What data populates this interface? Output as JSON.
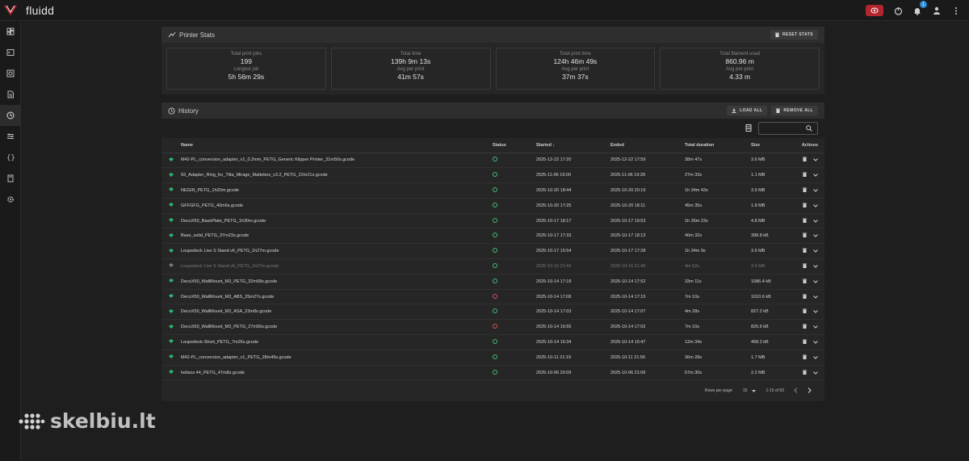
{
  "app": {
    "title": "fluidd",
    "notification_count": "1"
  },
  "icons": {
    "logo": "fluidd-logo-icon",
    "estop": "emergency-stop-icon",
    "sidebar": [
      "dashboard-icon",
      "console-icon",
      "camera-icon",
      "jobs-icon",
      "history-icon",
      "tune-icon",
      "config-icon",
      "system-icon",
      "settings-icon"
    ]
  },
  "colors": {
    "accent": "#2e8bd6",
    "success": "#3fbf6f",
    "error": "#e05050",
    "estop": "#b3262e",
    "file_icon": "#2bb673"
  },
  "stats_panel": {
    "title": "Printer Stats",
    "reset_label": "RESET STATS",
    "cards": [
      {
        "label1": "Total print jobs",
        "value1": "199",
        "label2": "Longest job",
        "value2": "5h 56m 29s"
      },
      {
        "label1": "Total time",
        "value1": "139h 9m 13s",
        "label2": "Avg per print",
        "value2": "41m 57s"
      },
      {
        "label1": "Total print time",
        "value1": "124h 46m 49s",
        "label2": "Avg per print",
        "value2": "37m 37s"
      },
      {
        "label1": "Total filament used",
        "value1": "860.96 m",
        "label2": "Avg per print",
        "value2": "4.33 m"
      }
    ]
  },
  "history": {
    "title": "History",
    "load_all": "LOAD ALL",
    "remove_all": "REMOVE ALL",
    "columns": {
      "name": "Name",
      "status": "Status",
      "started": "Started ↓",
      "ended": "Ended",
      "duration": "Total duration",
      "size": "Size",
      "actions": "Actions"
    },
    "rows": [
      {
        "name": "M42-PL_conversion_adapter_v1_0.2mm_PETG_Generic Klipper Printer_31m50s.gcode",
        "status": "ok",
        "started": "2025-12-22 17:20",
        "ended": "2025-12-22 17:59",
        "duration": "38m 47s",
        "size": "3.6 MB",
        "dim": false
      },
      {
        "name": "93_Adapter_Ring_for_Tilta_Mirage_Mattebox_v3.2_PETG_22m21s.gcode",
        "status": "ok",
        "started": "2025-11-06 19:00",
        "ended": "2025-11-06 19:28",
        "duration": "27m 33s",
        "size": "1.1 MB",
        "dim": false
      },
      {
        "name": "NEGIR_PETG_1h20m.gcode",
        "status": "ok",
        "started": "2025-10-20 18:44",
        "ended": "2025-10-20 20:19",
        "duration": "1h 34m 43s",
        "size": "3.5 MB",
        "dim": false
      },
      {
        "name": "GFFGFG_PETG_40m6s.gcode",
        "status": "ok",
        "started": "2025-10-20 17:25",
        "ended": "2025-10-20 18:11",
        "duration": "45m 35s",
        "size": "1.8 MB",
        "dim": false
      },
      {
        "name": "DecoX50_BasePlate_PETG_1h30m.gcode",
        "status": "ok",
        "started": "2025-10-17 18:17",
        "ended": "2025-10-17 19:53",
        "duration": "1h 36m 23s",
        "size": "4.8 MB",
        "dim": false
      },
      {
        "name": "Base_solid_PETG_37m23s.gcode",
        "status": "ok",
        "started": "2025-10-17 17:33",
        "ended": "2025-10-17 18:13",
        "duration": "40m 32s",
        "size": "398.8 kB",
        "dim": false
      },
      {
        "name": "Loupedeck Live S Stand v6_PETG_1h27m.gcode",
        "status": "ok",
        "started": "2025-10-17 15:54",
        "ended": "2025-10-17 17:28",
        "duration": "1h 34m 9s",
        "size": "3.6 MB",
        "dim": false
      },
      {
        "name": "Loupedeck Live S Stand v6_PETG_1h27m.gcode",
        "status": "ok",
        "started": "2025-10-16 21:43",
        "ended": "2025-10-16 21:49",
        "duration": "4m 52s",
        "size": "3.6 MB",
        "dim": true
      },
      {
        "name": "DecoX50_WallMount_M3_PETG_32m58s.gcode",
        "status": "ok",
        "started": "2025-10-14 17:18",
        "ended": "2025-10-14 17:52",
        "duration": "33m 11s",
        "size": "1086.4 kB",
        "dim": false
      },
      {
        "name": "DecoX50_WallMount_M3_ABS_25m27s.gcode",
        "status": "err",
        "started": "2025-10-14 17:08",
        "ended": "2025-10-14 17:15",
        "duration": "7m 10s",
        "size": "1010.6 kB",
        "dim": false
      },
      {
        "name": "DecoX50_WallMount_M3_ASA_23m8s.gcode",
        "status": "ok",
        "started": "2025-10-14 17:03",
        "ended": "2025-10-14 17:07",
        "duration": "4m 28s",
        "size": "827.2 kB",
        "dim": false
      },
      {
        "name": "DecoX50_WallMount_M3_PETG_27m56s.gcode",
        "status": "err",
        "started": "2025-10-14 16:55",
        "ended": "2025-10-14 17:02",
        "duration": "7m 10s",
        "size": "826.6 kB",
        "dim": false
      },
      {
        "name": "Loupedeck-Short_PETG_7m26s.gcode",
        "status": "ok",
        "started": "2025-10-14 16:34",
        "ended": "2025-10-14 16:47",
        "duration": "12m 34s",
        "size": "458.2 kB",
        "dim": false
      },
      {
        "name": "M42-PL_conversion_adapter_v1_PETG_28m45s.gcode",
        "status": "ok",
        "started": "2025-10-11 21:19",
        "ended": "2025-10-11 21:56",
        "duration": "36m 28s",
        "size": "1.7 MB",
        "dim": false
      },
      {
        "name": "helisos 44_PETG_47m8s.gcode",
        "status": "ok",
        "started": "2025-10-06 20:09",
        "ended": "2025-10-06 21:06",
        "duration": "57m 30s",
        "size": "2.2 MB",
        "dim": false
      }
    ],
    "pagination": {
      "rows_label": "Rows per page:",
      "rows_value": "15",
      "range": "1-15 of 50"
    }
  },
  "watermark": "skelbiu.lt"
}
